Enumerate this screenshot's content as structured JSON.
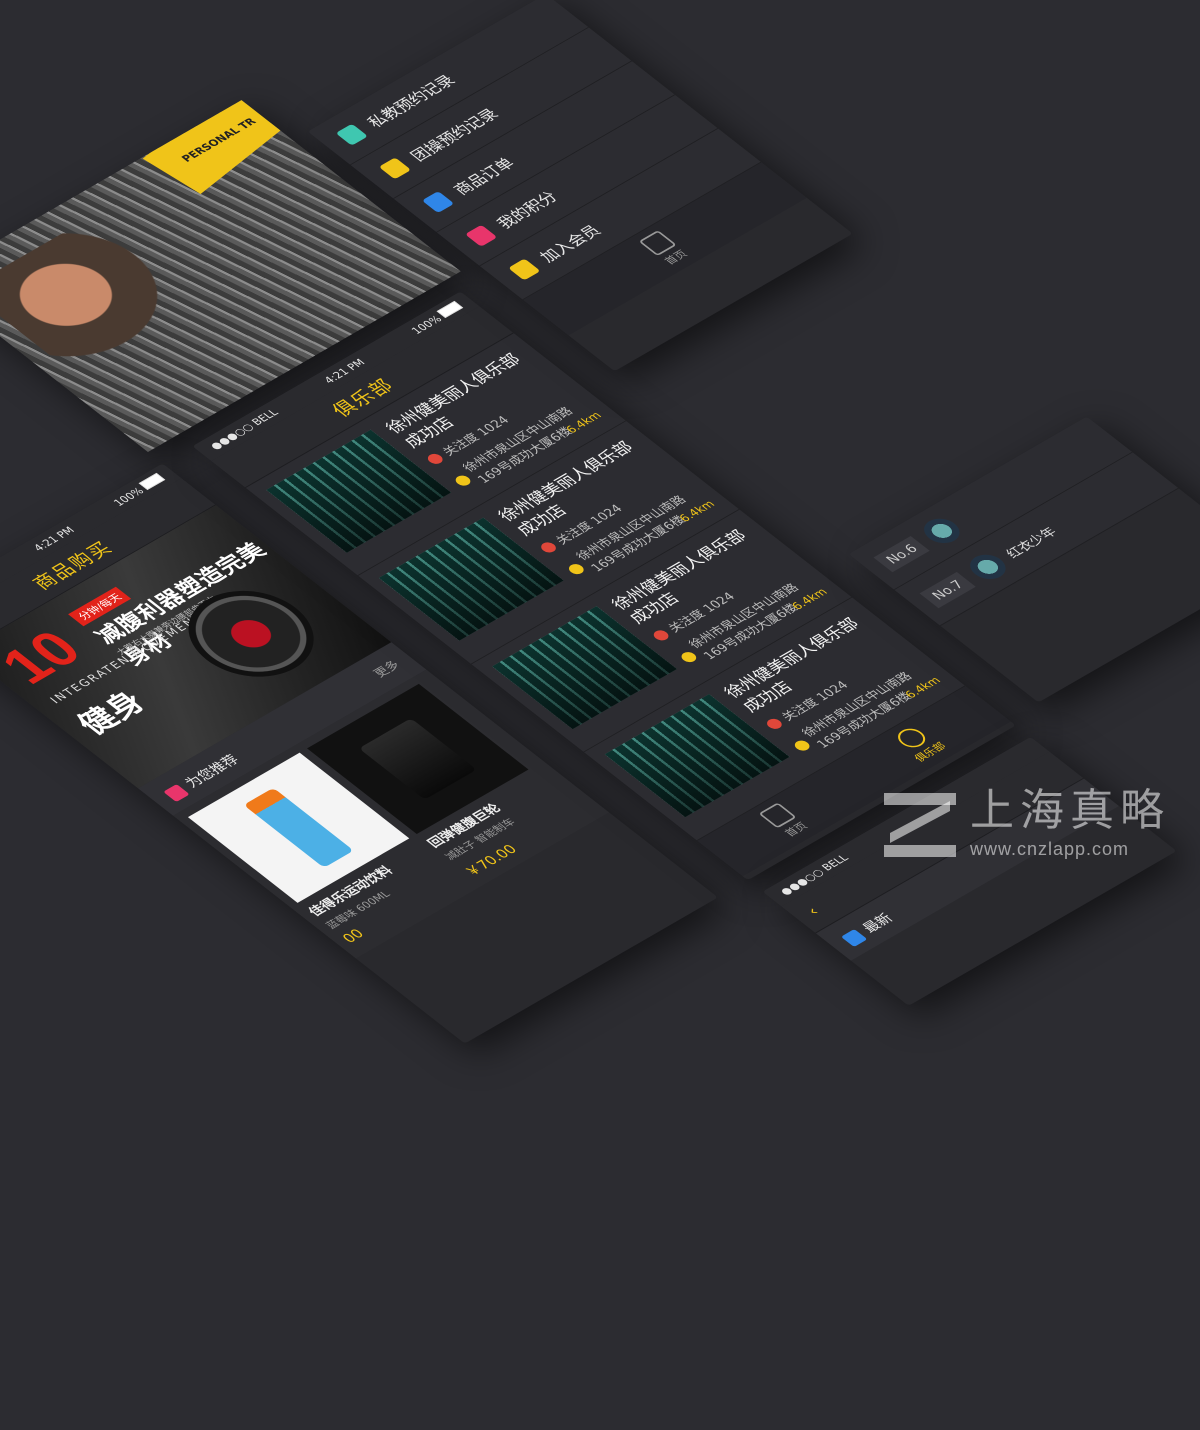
{
  "colors": {
    "accent": "#f0c419",
    "background": "#2c2c31",
    "promo_red": "#e2231a"
  },
  "status": {
    "carrier": "●●●○○ BELL",
    "time": "4:21 PM",
    "battery": "100%"
  },
  "shop": {
    "title": "商品购买",
    "banner": {
      "number": "10",
      "tag": "分钟/每天",
      "headline": "减腹利器塑造完美身材",
      "sub": "大腹右大腹兼旁边腰部曲不力",
      "en": "INTEGRATEN MOVEMENT",
      "big": "健身"
    },
    "section_label": "为您推荐",
    "more_label": "更多",
    "products": [
      {
        "name": "佳得乐运动饮料",
        "desc": "蓝莓味 600ML",
        "price": "00"
      },
      {
        "name": "回弹健腹巨轮",
        "desc": "减肚子 智能制车",
        "price": "￥70.00"
      }
    ]
  },
  "club": {
    "title": "俱乐部",
    "items": [
      {
        "name": "徐州健美丽人俱乐部成功店",
        "fans": "关注度 1024",
        "address": "徐州市泉山区中山南路169号成功大厦6楼",
        "distance": "6.4km"
      },
      {
        "name": "徐州健美丽人俱乐部成功店",
        "fans": "关注度 1024",
        "address": "徐州市泉山区中山南路169号成功大厦6楼",
        "distance": "6.4km"
      },
      {
        "name": "徐州健美丽人俱乐部成功店",
        "fans": "关注度 1024",
        "address": "徐州市泉山区中山南路169号成功大厦6楼",
        "distance": "6.4km"
      },
      {
        "name": "徐州健美丽人俱乐部成功店",
        "fans": "关注度 1024",
        "address": "徐州市泉山区中山南路169号成功大厦6楼",
        "distance": "6.4km"
      }
    ]
  },
  "menu": {
    "items": [
      {
        "label": "私教预约记录",
        "icon": "trainer-icon",
        "color": "#3fc7b0"
      },
      {
        "label": "团操预约记录",
        "icon": "group-icon",
        "color": "#f0c419"
      },
      {
        "label": "商品订单",
        "icon": "cart-icon",
        "color": "#2f86e8"
      },
      {
        "label": "我的积分",
        "icon": "points-icon",
        "color": "#e8356b"
      },
      {
        "label": "加入会员",
        "icon": "member-icon",
        "color": "#f0c419"
      }
    ]
  },
  "tabs": {
    "home": "首页",
    "club": "俱乐部"
  },
  "banner_photo": {
    "text": "PERSONAL TR"
  },
  "ranking": {
    "items": [
      {
        "rank": "No.6",
        "name": ""
      },
      {
        "rank": "No.7",
        "name": "红衣少年"
      }
    ]
  },
  "news": {
    "label": "最新"
  },
  "watermark": {
    "title": "上海真略",
    "url": "www.cnzlapp.com"
  }
}
